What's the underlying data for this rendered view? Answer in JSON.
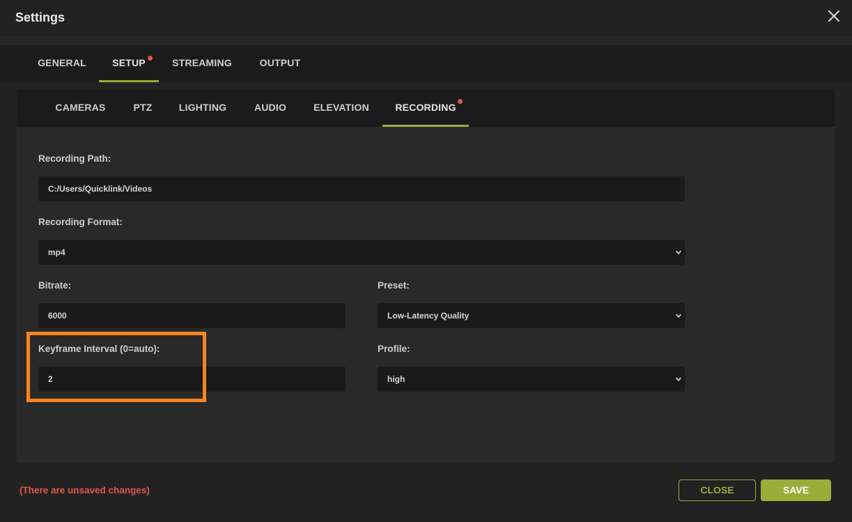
{
  "window": {
    "title": "Settings",
    "close_icon": "close-icon"
  },
  "main_tabs": [
    {
      "label": "GENERAL"
    },
    {
      "label": "SETUP",
      "active": true,
      "has_changes": true
    },
    {
      "label": "STREAMING"
    },
    {
      "label": "OUTPUT"
    }
  ],
  "sub_tabs": [
    {
      "label": "CAMERAS"
    },
    {
      "label": "PTZ"
    },
    {
      "label": "LIGHTING"
    },
    {
      "label": "AUDIO"
    },
    {
      "label": "ELEVATION"
    },
    {
      "label": "RECORDING",
      "active": true,
      "has_changes": true
    }
  ],
  "form": {
    "recording_path": {
      "label": "Recording Path:",
      "value": "C:/Users/Quicklink/Videos"
    },
    "recording_format": {
      "label": "Recording Format:",
      "value": "mp4"
    },
    "bitrate": {
      "label": "Bitrate:",
      "value": "6000"
    },
    "preset": {
      "label": "Preset:",
      "value": "Low-Latency Quality"
    },
    "keyframe_interval": {
      "label": "Keyframe Interval (0=auto):",
      "value": "2"
    },
    "profile": {
      "label": "Profile:",
      "value": "high"
    }
  },
  "footer": {
    "unsaved_notice": "(There are unsaved changes)",
    "close_label": "CLOSE",
    "save_label": "SAVE"
  },
  "colors": {
    "accent": "#9aad3a",
    "warning": "#e2554a",
    "highlight": "#f58520"
  }
}
